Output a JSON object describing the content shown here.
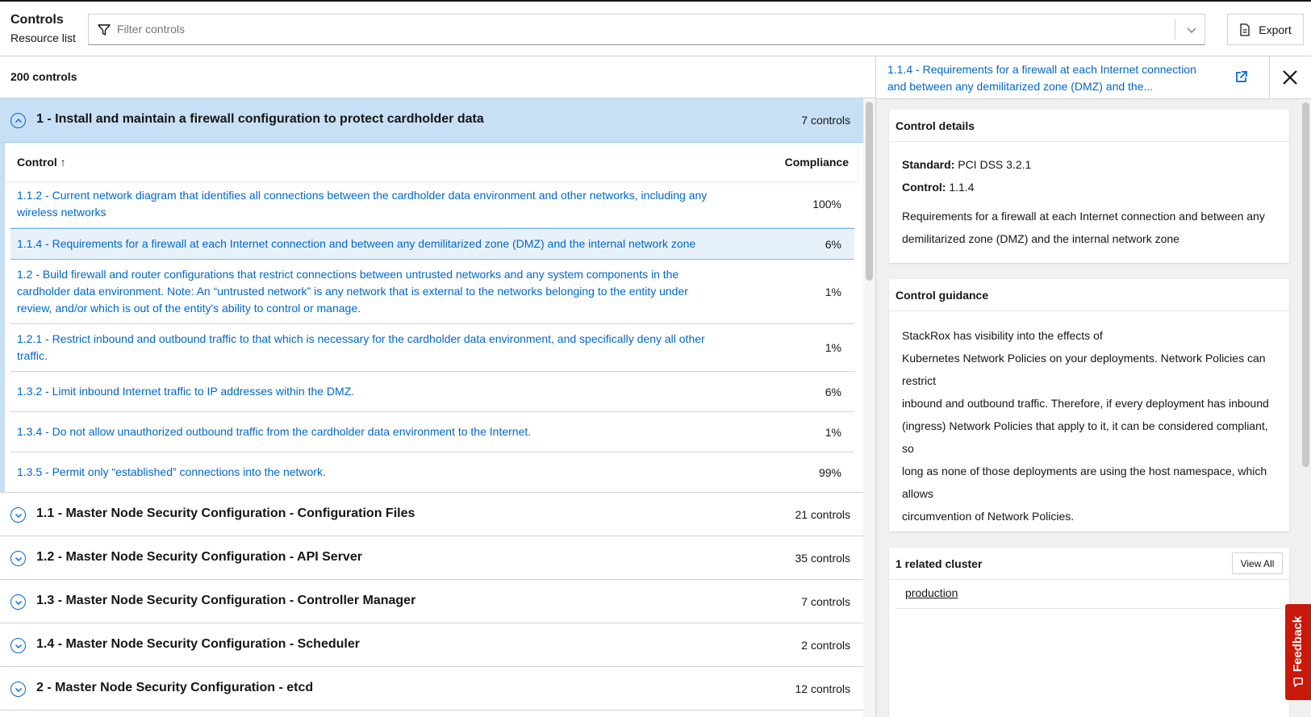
{
  "header": {
    "title": "Controls",
    "subtitle": "Resource list",
    "filter_placeholder": "Filter controls",
    "export_label": "Export"
  },
  "list": {
    "count_label": "200 controls",
    "expanded_group": {
      "title": "1 - Install and maintain a firewall configuration to protect cardholder data",
      "count": "7 controls"
    },
    "table": {
      "col_control": "Control ↑",
      "col_compliance": "Compliance",
      "rows": [
        {
          "name": "1.1.2 - Current network diagram that identifies all connections between the cardholder data environment and other networks, including any wireless networks",
          "value": "100%"
        },
        {
          "name": "1.1.4 - Requirements for a firewall at each Internet connection and between any demilitarized zone (DMZ) and the internal network zone",
          "value": "6%"
        },
        {
          "name": "1.2 - Build firewall and router configurations that restrict connections between untrusted networks and any system components in the cardholder data environment. Note: An “untrusted network” is any network that is external to the networks belonging to the entity under review, and/or which is out of the entity's ability to control or manage.",
          "value": "1%"
        },
        {
          "name": "1.2.1 - Restrict inbound and outbound traffic to that which is necessary for the cardholder data environment, and specifically deny all other traffic.",
          "value": "1%"
        },
        {
          "name": "1.3.2 - Limit inbound Internet traffic to IP addresses within the DMZ.",
          "value": "6%"
        },
        {
          "name": "1.3.4 - Do not allow unauthorized outbound traffic from the cardholder data environment to the Internet.",
          "value": "1%"
        },
        {
          "name": "1.3.5 - Permit only “established” connections into the network.",
          "value": "99%"
        }
      ]
    },
    "groups": [
      {
        "title": "1.1 - Master Node Security Configuration - Configuration Files",
        "count": "21 controls"
      },
      {
        "title": "1.2 - Master Node Security Configuration - API Server",
        "count": "35 controls"
      },
      {
        "title": "1.3 - Master Node Security Configuration - Controller Manager",
        "count": "7 controls"
      },
      {
        "title": "1.4 - Master Node Security Configuration - Scheduler",
        "count": "2 controls"
      },
      {
        "title": "2 - Master Node Security Configuration - etcd",
        "count": "12 controls"
      }
    ]
  },
  "panel": {
    "title": "1.1.4 - Requirements for a firewall at each Internet connection and between any demilitarized zone (DMZ) and the...",
    "details": {
      "heading": "Control details",
      "standard_label": "Standard:",
      "standard_value": "PCI DSS 3.2.1",
      "control_label": "Control:",
      "control_value": "1.1.4",
      "description": "Requirements for a firewall at each Internet connection and between any demilitarized zone (DMZ) and the internal network zone"
    },
    "guidance": {
      "heading": "Control guidance",
      "lines": [
        "StackRox has visibility into the effects of",
        "Kubernetes Network Policies on your deployments. Network Policies can restrict",
        "inbound and outbound traffic. Therefore, if every deployment has inbound (ingress) Network Policies that apply to it, it can be considered compliant, so",
        "long as none of those deployments are using the host namespace, which allows",
        "circumvention of Network Policies."
      ]
    },
    "clusters": {
      "heading": "1 related cluster",
      "view_all_label": "View All",
      "items": [
        "production"
      ]
    }
  },
  "feedback_label": "Feedback",
  "colors": {
    "link": "#0066cc",
    "expanded_bg": "#c8e0f5",
    "selected_row_bg": "#e7f1fa",
    "feedback_bg": "#c9190b"
  }
}
